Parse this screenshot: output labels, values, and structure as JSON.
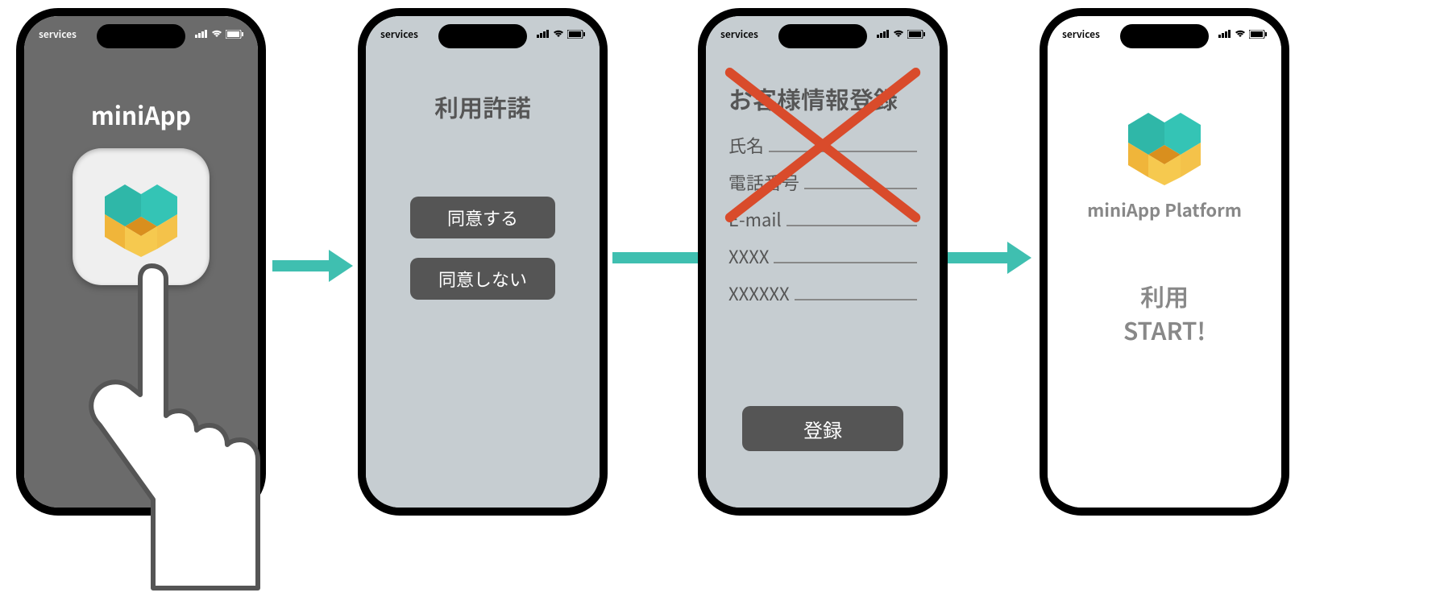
{
  "statusbar": {
    "carrier": "services"
  },
  "screen1": {
    "title": "miniApp"
  },
  "screen2": {
    "heading": "利用許諾",
    "agree": "同意する",
    "disagree": "同意しない"
  },
  "screen3": {
    "heading": "お客様情報登録",
    "fields": {
      "name": "氏名",
      "phone": "電話番号",
      "email": "E-mail",
      "x4": "XXXX",
      "x6": "XXXXXX"
    },
    "register": "登録"
  },
  "screen4": {
    "brand": "miniApp Platform",
    "line1": "利用",
    "line2": "START!"
  },
  "colors": {
    "arrow": "#3fbfb0",
    "cross": "#d94b2b"
  }
}
